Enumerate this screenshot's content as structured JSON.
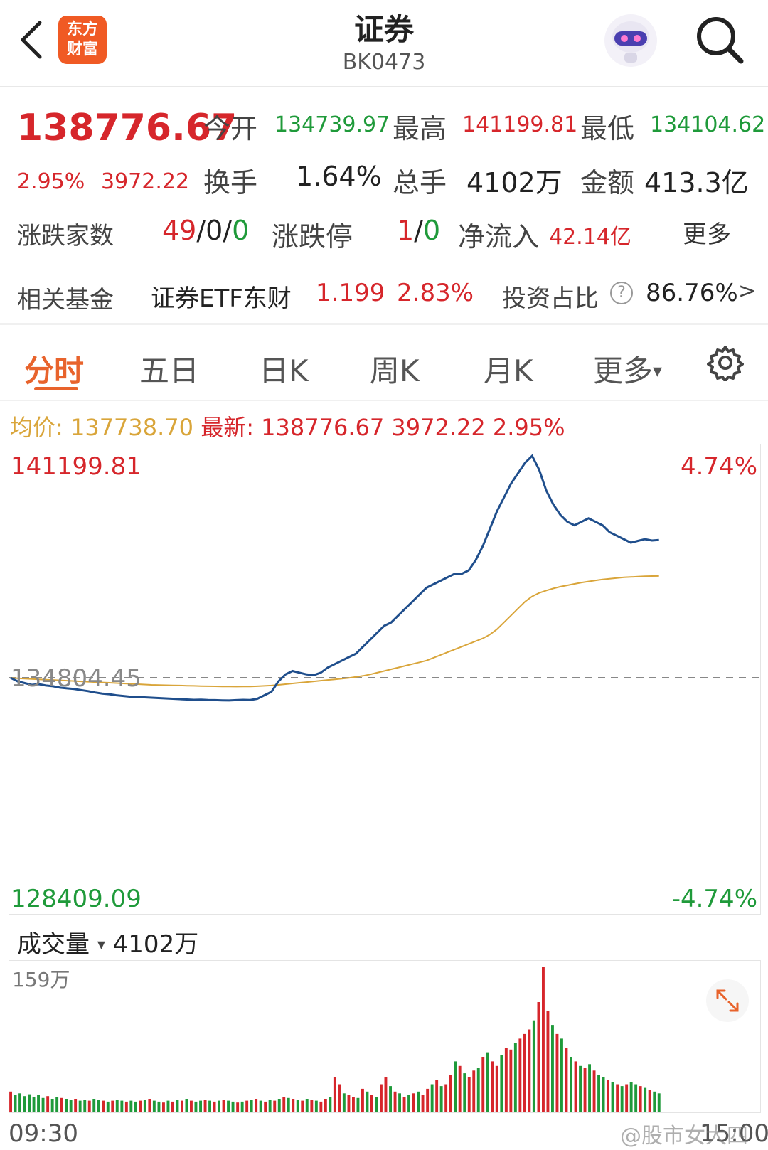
{
  "header": {
    "title": "证券",
    "code": "BK0473",
    "logo_text_line1": "东方",
    "logo_text_line2": "财富"
  },
  "quote": {
    "price": "138776.67",
    "change_pct": "2.95%",
    "change": "3972.22",
    "open_label": "今开",
    "open": "134739.97",
    "high_label": "最高",
    "high": "141199.81",
    "low_label": "最低",
    "low": "134104.62",
    "turnover_label": "换手",
    "turnover": "1.64%",
    "volume_label": "总手",
    "volume": "4102万",
    "amount_label": "金额",
    "amount": "413.3亿",
    "advdec_label": "涨跌家数",
    "adv": "49",
    "sep1": "/",
    "flat": "0",
    "sep2": "/",
    "dec": "0",
    "limit_label": "涨跌停",
    "limit_up": "1",
    "sep3": "/",
    "limit_down": "0",
    "netflow_label": "净流入",
    "netflow": "42.14亿",
    "more": "更多"
  },
  "fund": {
    "label": "相关基金",
    "name": "证券ETF东财",
    "price": "1.199",
    "pct": "2.83%",
    "ratio_label": "投资占比",
    "help": "?",
    "ratio": "86.76%",
    "arrow": ">"
  },
  "tabs": [
    {
      "label": "分时"
    },
    {
      "label": "五日"
    },
    {
      "label": "日K"
    },
    {
      "label": "周K"
    },
    {
      "label": "月K"
    },
    {
      "label": "更多"
    }
  ],
  "tabs_more_arrow": "▾",
  "info_bar": {
    "avg_label": "均价:",
    "avg": "137738.70",
    "latest_label": "最新:",
    "latest": "138776.67",
    "change": "3972.22",
    "pct": "2.95%"
  },
  "volume_header": {
    "label": "成交量",
    "arrow": "▾",
    "total": "4102万"
  },
  "watermark": "@股市女大四",
  "colors": {
    "up": "#d6262b",
    "down": "#1f9a3a",
    "price_line": "#1f4e8c",
    "avg_line": "#d9a53a",
    "accent": "#e8632c"
  },
  "chart_data": {
    "type": "line",
    "title": "",
    "y_top_label": "141199.81",
    "y_mid_label": "134804.45",
    "y_bottom_label": "128409.09",
    "pct_top_label": "4.74%",
    "pct_bottom_label": "-4.74%",
    "ylim": [
      128409.09,
      141199.81
    ],
    "prev_close": 134804.45,
    "x_start_label": "09:30",
    "x_end_label": "15:00",
    "series": [
      {
        "values": [
          134800,
          134700,
          134650,
          134600,
          134620,
          134580,
          134560,
          134520,
          134500,
          134480,
          134450,
          134420,
          134380,
          134350,
          134330,
          134300,
          134280,
          134260,
          134250,
          134240,
          134230,
          134220,
          134210,
          134200,
          134190,
          134180,
          134170,
          134175,
          134165,
          134160,
          134155,
          134150,
          134160,
          134170,
          134165,
          134200,
          134300,
          134400,
          134700,
          134900,
          135000,
          134950,
          134900,
          134880,
          134950,
          135100,
          135200,
          135300,
          135400,
          135500,
          135700,
          135900,
          136100,
          136300,
          136400,
          136600,
          136800,
          137000,
          137200,
          137400,
          137500,
          137600,
          137700,
          137800,
          137800,
          137900,
          138200,
          138600,
          139100,
          139600,
          140000,
          140400,
          140700,
          141000,
          141199,
          140800,
          140200,
          139800,
          139500,
          139300,
          139200,
          139300,
          139400,
          139300,
          139200,
          139000,
          138900,
          138800,
          138700,
          138750,
          138800,
          138760,
          138776
        ]
      },
      {
        "values": [
          134800,
          134790,
          134780,
          134770,
          134760,
          134750,
          134740,
          134730,
          134720,
          134710,
          134700,
          134690,
          134680,
          134670,
          134660,
          134650,
          134640,
          134630,
          134620,
          134610,
          134600,
          134595,
          134590,
          134585,
          134580,
          134575,
          134570,
          134565,
          134560,
          134558,
          134555,
          134552,
          134550,
          134552,
          134555,
          134560,
          134570,
          134580,
          134600,
          134620,
          134640,
          134660,
          134680,
          134700,
          134720,
          134740,
          134760,
          134780,
          134800,
          134830,
          134860,
          134900,
          134950,
          135000,
          135050,
          135100,
          135150,
          135200,
          135250,
          135300,
          135380,
          135460,
          135540,
          135620,
          135700,
          135780,
          135860,
          135940,
          136050,
          136200,
          136400,
          136600,
          136800,
          137000,
          137150,
          137250,
          137320,
          137380,
          137430,
          137470,
          137510,
          137550,
          137580,
          137610,
          137640,
          137660,
          137680,
          137700,
          137710,
          137720,
          137730,
          137735,
          137738
        ]
      }
    ],
    "volume": {
      "label": "成交量",
      "max_label": "159万",
      "values": [
        22,
        18,
        20,
        17,
        19,
        16,
        18,
        15,
        17,
        14,
        16,
        15,
        14,
        13,
        14,
        12,
        13,
        12,
        14,
        13,
        12,
        11,
        12,
        13,
        12,
        11,
        12,
        11,
        12,
        13,
        14,
        12,
        11,
        10,
        12,
        11,
        13,
        12,
        14,
        12,
        11,
        12,
        13,
        12,
        11,
        12,
        13,
        12,
        11,
        10,
        11,
        12,
        13,
        14,
        12,
        11,
        13,
        12,
        14,
        16,
        15,
        14,
        13,
        12,
        14,
        13,
        12,
        11,
        14,
        16,
        38,
        30,
        20,
        18,
        16,
        15,
        25,
        22,
        18,
        16,
        30,
        38,
        28,
        22,
        20,
        16,
        18,
        20,
        22,
        18,
        25,
        30,
        35,
        28,
        30,
        40,
        55,
        50,
        42,
        38,
        45,
        48,
        60,
        65,
        55,
        50,
        62,
        70,
        68,
        75,
        80,
        85,
        90,
        100,
        120,
        159,
        110,
        95,
        85,
        80,
        70,
        60,
        55,
        50,
        48,
        52,
        45,
        40,
        38,
        35,
        32,
        30,
        28,
        30,
        32,
        30,
        28,
        26,
        24,
        22,
        20
      ],
      "colors": [
        "r",
        "g",
        "g",
        "g",
        "g",
        "g",
        "g",
        "g",
        "r",
        "g",
        "g",
        "r",
        "g",
        "g",
        "r",
        "g",
        "g",
        "r",
        "g",
        "g",
        "r",
        "g",
        "r",
        "g",
        "g",
        "r",
        "g",
        "g",
        "r",
        "g",
        "r",
        "g",
        "g",
        "r",
        "g",
        "r",
        "g",
        "r",
        "g",
        "r",
        "g",
        "g",
        "r",
        "g",
        "r",
        "g",
        "r",
        "g",
        "g",
        "r",
        "g",
        "r",
        "g",
        "r",
        "g",
        "r",
        "g",
        "r",
        "g",
        "r",
        "g",
        "r",
        "g",
        "r",
        "g",
        "r",
        "g",
        "r",
        "r",
        "g",
        "r",
        "r",
        "g",
        "r",
        "r",
        "g",
        "r",
        "g",
        "r",
        "g",
        "r",
        "r",
        "g",
        "r",
        "g",
        "r",
        "g",
        "r",
        "g",
        "r",
        "r",
        "g",
        "r",
        "g",
        "r",
        "r",
        "g",
        "r",
        "g",
        "r",
        "r",
        "g",
        "r",
        "g",
        "r",
        "r",
        "g",
        "r",
        "r",
        "g",
        "r",
        "r",
        "r",
        "g",
        "r",
        "r",
        "r",
        "g",
        "r",
        "g",
        "r",
        "g",
        "r",
        "g",
        "r",
        "g",
        "r",
        "g",
        "g",
        "r",
        "g",
        "r",
        "g",
        "r",
        "g",
        "g",
        "r",
        "g",
        "r",
        "g"
      ]
    }
  }
}
